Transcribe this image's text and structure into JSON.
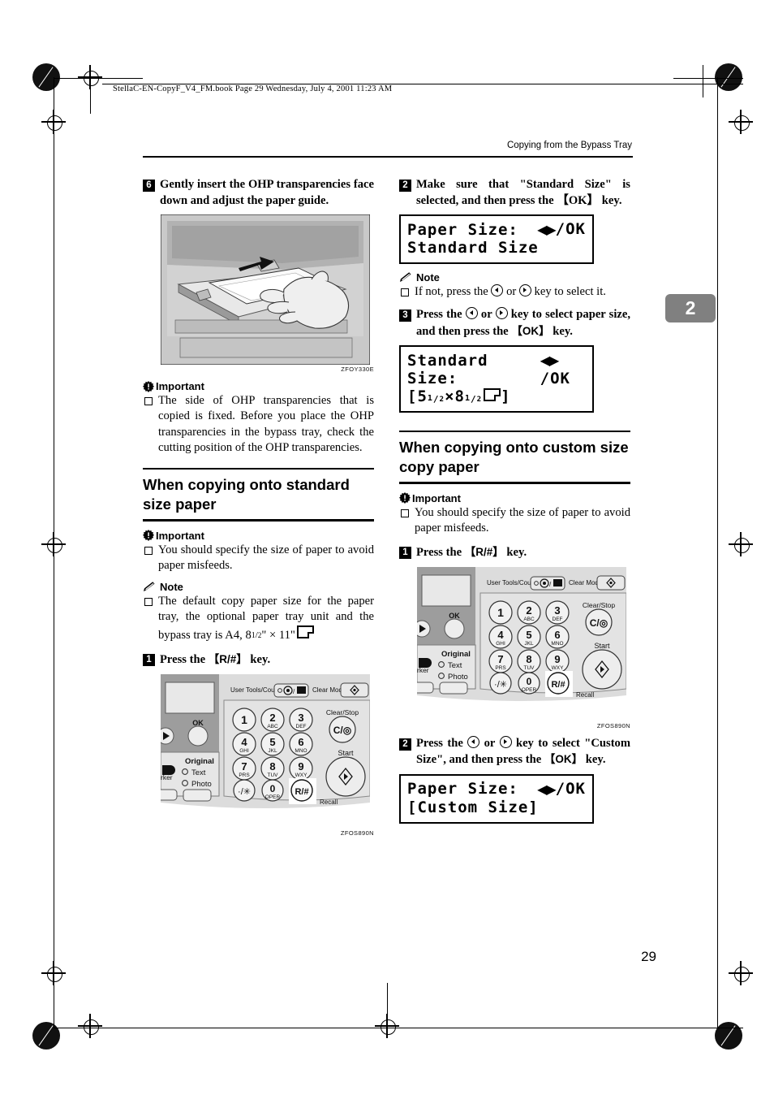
{
  "page": {
    "book_info": "StellaC-EN-CopyF_V4_FM.book  Page 29  Wednesday, July 4, 2001  11:23 AM",
    "running_header": "Copying from the Bypass Tray",
    "chapter_tab": "2",
    "page_number": "29"
  },
  "left_column": {
    "step6": {
      "num": "6",
      "text": "Gently insert the OHP transparencies face down and adjust the paper guide."
    },
    "figure_tray": {
      "code": "ZFOY330E",
      "alt": "bypass-tray-photo"
    },
    "important1": {
      "label": "Important",
      "item": "The side of OHP transparencies that is copied is fixed. Before you place the OHP transparencies in the bypass tray, check the cutting position of the OHP transparencies."
    },
    "section": {
      "title": "When copying onto standard size paper"
    },
    "important2": {
      "label": "Important",
      "item": "You should specify the size of paper to avoid paper misfeeds."
    },
    "note": {
      "label": "Note",
      "item_prefix": "The default copy paper size for the paper tray, the optional paper tray unit and the bypass tray is A4, ",
      "item_size": "8",
      "item_frac_num": "1",
      "item_frac_den": "2",
      "item_size_tail": "\" × 11\""
    },
    "step1": {
      "num": "1",
      "text_before": "Press the ",
      "key": "R/#",
      "text_after": " key."
    },
    "figure_panel": {
      "code": "ZFOS890N"
    }
  },
  "right_column": {
    "step2a": {
      "num": "2",
      "text": "Make sure that \"Standard Size\" is selected, and then press the 【OK】 key."
    },
    "lcd1": {
      "line1_left": "Paper Size:",
      "line1_right": "/OK",
      "line2": "Standard Size"
    },
    "note": {
      "label": "Note",
      "item_before": "If not, press the ",
      "item_mid": " or ",
      "item_after": " key to select it."
    },
    "step3": {
      "num": "3",
      "text_before": "Press the ",
      "text_mid": " or ",
      "text_after": " key to select paper size, and then press the 【OK】 key."
    },
    "lcd2": {
      "line1_left": "Standard Size:",
      "line1_right": "/OK",
      "line2_open": "[5",
      "line2_f1n": "1",
      "line2_f1d": "2",
      "line2_times": "×8",
      "line2_f2n": "1",
      "line2_f2d": "2",
      "line2_close": "]"
    },
    "section": {
      "title": "When copying onto custom size copy paper"
    },
    "important": {
      "label": "Important",
      "item": "You should specify the size of paper to avoid paper misfeeds."
    },
    "step1": {
      "num": "1",
      "text_before": "Press the ",
      "key": "R/#",
      "text_after": " key."
    },
    "figure_panel": {
      "code": "ZFOS890N"
    },
    "step2b": {
      "num": "2",
      "text_before": "Press the ",
      "text_mid": " or ",
      "text_after": " key to select \"Custom Size\", and then press the 【OK】 key."
    },
    "lcd3": {
      "line1_left": "Paper Size:",
      "line1_right": "/OK",
      "line2": "[Custom Size]"
    }
  },
  "control_panel": {
    "user_tools_label": "User Tools/Counter",
    "clear_modes_label": "Clear Modes",
    "ok_label": "OK",
    "original_label": "Original",
    "text_label": "Text",
    "photo_label": "Photo",
    "marker_label": "rker",
    "clear_stop_label": "Clear/Stop",
    "clear_stop_key": "C/",
    "start_label": "Start",
    "recall_label": "Recall",
    "keys": [
      {
        "digit": "1",
        "letters": ""
      },
      {
        "digit": "2",
        "letters": "ABC"
      },
      {
        "digit": "3",
        "letters": "DEF"
      },
      {
        "digit": "4",
        "letters": "GHI"
      },
      {
        "digit": "5",
        "letters": "JKL"
      },
      {
        "digit": "6",
        "letters": "MNO"
      },
      {
        "digit": "7",
        "letters": "PRS"
      },
      {
        "digit": "8",
        "letters": "TUV"
      },
      {
        "digit": "9",
        "letters": "WXY"
      },
      {
        "digit": "·/✻",
        "letters": ""
      },
      {
        "digit": "0",
        "letters": "OPER"
      },
      {
        "digit": "R/#",
        "letters": ""
      }
    ]
  },
  "colors": {
    "panel_body": "#d9d9d9",
    "panel_dark": "#9a9a9a",
    "panel_light": "#e9e9e9",
    "chapter_tab": "#808080",
    "photo_bg": "#c9c9c9"
  }
}
